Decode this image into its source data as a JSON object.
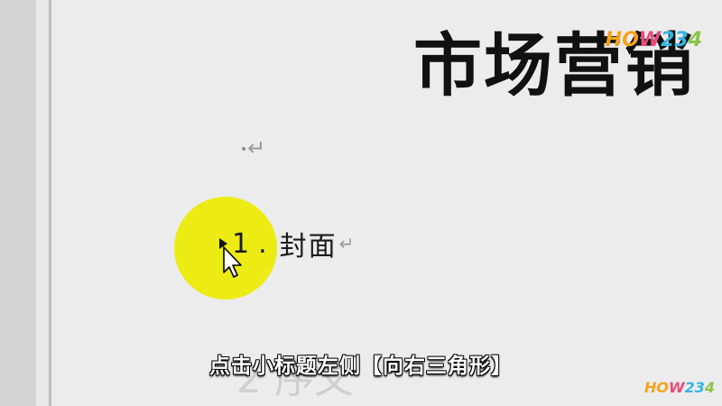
{
  "document": {
    "title": "市场营销",
    "empty_paragraph_mark": "↵",
    "heading": {
      "number": "1",
      "separator": ".",
      "text": "封面",
      "paragraph_mark": "↵"
    },
    "next_heading_partial": "2 序文"
  },
  "subtitle": "点击小标题左侧【向右三角形】",
  "watermark": {
    "parts": [
      "HO",
      "W",
      "23",
      "4"
    ]
  },
  "colors": {
    "highlight": "#ecec14",
    "page": "#ececec"
  },
  "icons": {
    "cursor": "mouse-pointer-icon",
    "collapse": "right-triangle-icon"
  }
}
